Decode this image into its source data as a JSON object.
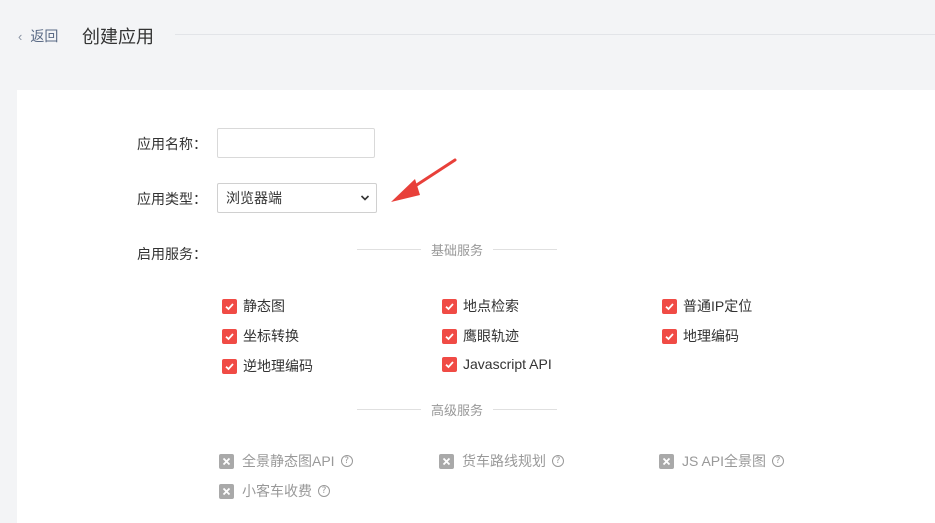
{
  "header": {
    "back_label": "返回",
    "title": "创建应用"
  },
  "form": {
    "name_label": "应用名称：",
    "name_value": "",
    "type_label": "应用类型：",
    "type_value": "浏览器端",
    "services_label": "启用服务："
  },
  "basic": {
    "title": "基础服务",
    "items": [
      "静态图",
      "地点检索",
      "普通IP定位",
      "坐标转换",
      "鹰眼轨迹",
      "地理编码",
      "逆地理编码",
      "Javascript API"
    ]
  },
  "advanced": {
    "title": "高级服务",
    "items": [
      "全景静态图API",
      "货车路线规划",
      "JS API全景图",
      "小客车收费"
    ]
  },
  "colors": {
    "checked": "#f04b45",
    "disabled": "#a9a9a9",
    "annotation_arrow": "#e8403a"
  },
  "icons": {
    "back": "chevron-left-icon",
    "help": "question-circle-icon",
    "check": "check-icon",
    "cross": "cross-icon"
  }
}
